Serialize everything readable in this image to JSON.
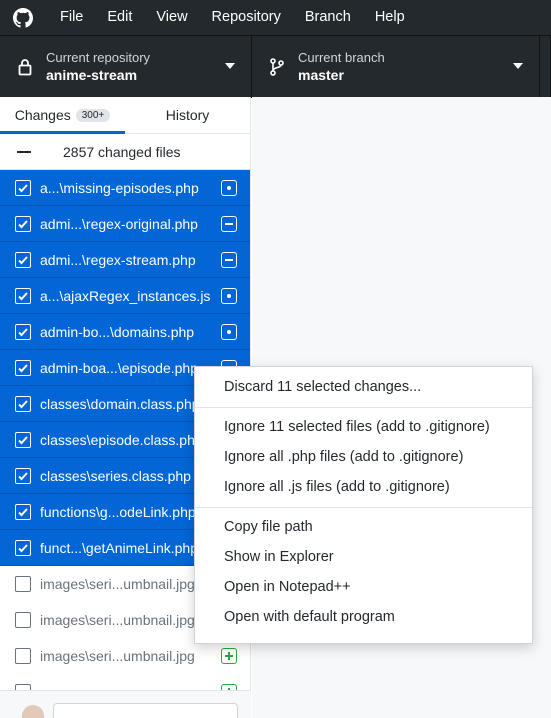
{
  "menu": {
    "items": [
      "File",
      "Edit",
      "View",
      "Repository",
      "Branch",
      "Help"
    ]
  },
  "toolbar": {
    "repo_label": "Current repository",
    "repo_value": "anime-stream",
    "branch_label": "Current branch",
    "branch_value": "master"
  },
  "sidebar": {
    "tabs": [
      {
        "label": "Changes",
        "count": "300+"
      },
      {
        "label": "History"
      }
    ],
    "header_text": "2857 changed files",
    "files": [
      {
        "name": "a...\\missing-episodes.php",
        "selected": true,
        "status": "modified"
      },
      {
        "name": "admi...\\regex-original.php",
        "selected": true,
        "status": "deleted"
      },
      {
        "name": "admi...\\regex-stream.php",
        "selected": true,
        "status": "deleted"
      },
      {
        "name": "a...\\ajaxRegex_instances.js",
        "selected": true,
        "status": "modified"
      },
      {
        "name": "admin-bo...\\domains.php",
        "selected": true,
        "status": "modified"
      },
      {
        "name": "admin-boa...\\episode.php",
        "selected": true,
        "status": "modified"
      },
      {
        "name": "classes\\domain.class.php",
        "selected": true,
        "status": "modified"
      },
      {
        "name": "classes\\episode.class.php",
        "selected": true,
        "status": "modified"
      },
      {
        "name": "classes\\series.class.php",
        "selected": true,
        "status": "modified"
      },
      {
        "name": "functions\\g...odeLink.php",
        "selected": true,
        "status": "modified"
      },
      {
        "name": "funct...\\getAnimeLink.php",
        "selected": true,
        "status": "modified"
      },
      {
        "name": "images\\seri...umbnail.jpg",
        "selected": false,
        "status": "added"
      },
      {
        "name": "images\\seri...umbnail.jpg",
        "selected": false,
        "status": "added"
      },
      {
        "name": "images\\seri...umbnail.jpg",
        "selected": false,
        "status": "added"
      },
      {
        "name": "",
        "selected": false,
        "status": "added"
      }
    ]
  },
  "context_menu": {
    "groups": [
      [
        "Discard 11 selected changes..."
      ],
      [
        "Ignore 11 selected files (add to .gitignore)",
        "Ignore all .php files (add to .gitignore)",
        "Ignore all .js files (add to .gitignore)"
      ],
      [
        "Copy file path",
        "Show in Explorer",
        "Open in Notepad++",
        "Open with default program"
      ]
    ]
  },
  "colors": {
    "chrome": "#24292e",
    "selection": "#0366d6",
    "added": "#28a745"
  }
}
